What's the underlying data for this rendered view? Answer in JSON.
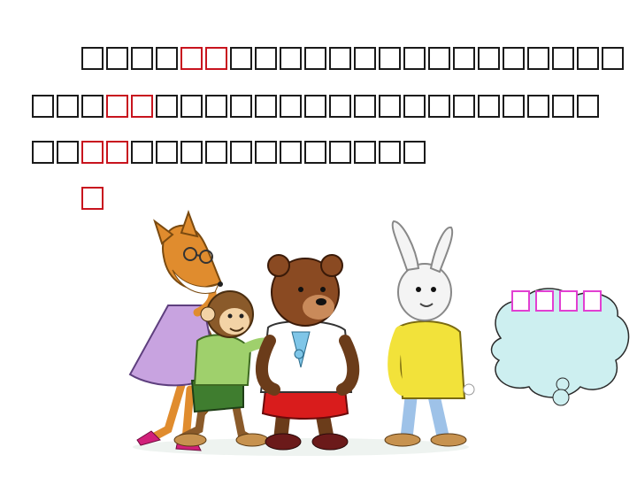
{
  "paragraph": {
    "line1": "□□□□□□□□□□□□□□□□□□□□□□□□□",
    "line2": "□□□□□□□□□□□□□□□□□□□□□□□□□□□",
    "line3": "□□□□□□□□□□□□□□□□□□□",
    "line4": "□"
  },
  "highlights": [
    "□□",
    "□□",
    "□□",
    "□"
  ],
  "thought_bubble": {
    "text": "□□□□"
  },
  "colors": {
    "text": "#1a1a1a",
    "highlight": "#c8141e",
    "bubble_text": "#e23fd2",
    "bubble_fill": "#cdeff0"
  },
  "illustration": {
    "characters": [
      "fox-icon",
      "monkey-icon",
      "bear-icon",
      "rabbit-icon"
    ]
  }
}
